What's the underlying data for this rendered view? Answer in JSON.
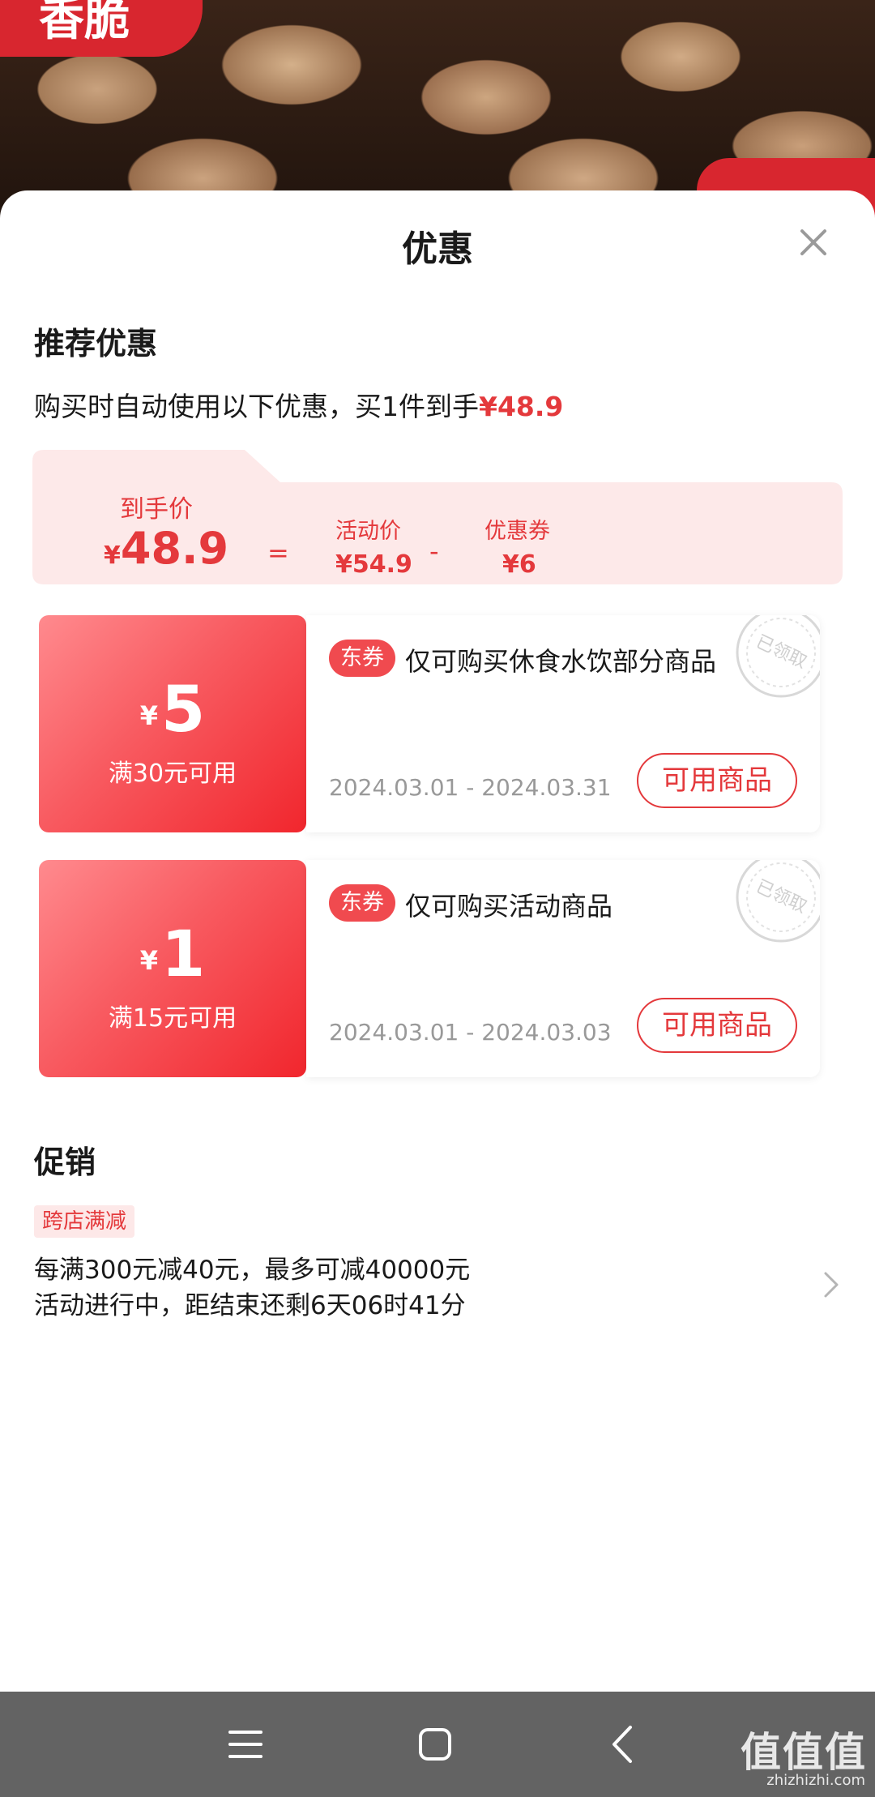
{
  "background": {
    "stamp_text": "香脆"
  },
  "sheet": {
    "title": "优惠",
    "recommend": {
      "title": "推荐优惠",
      "auto_text": "购买时自动使用以下优惠，买1件到手",
      "auto_price": "¥48.9"
    },
    "breakdown": {
      "final_label": "到手价",
      "final_currency": "¥",
      "final_value": "48.9",
      "equals": "=",
      "activity_label": "活动价",
      "activity_price": "¥54.9",
      "minus": "-",
      "coupon_label": "优惠券",
      "coupon_price": "¥6"
    },
    "coupons": [
      {
        "currency": "¥",
        "amount": "5",
        "condition": "满30元可用",
        "tag": "东券",
        "desc": "仅可购买休食水饮部分商品",
        "date": "2024.03.01 - 2024.03.31",
        "button": "可用商品",
        "stamp": "已领取"
      },
      {
        "currency": "¥",
        "amount": "1",
        "condition": "满15元可用",
        "tag": "东券",
        "desc": "仅可购买活动商品",
        "date": "2024.03.01 - 2024.03.03",
        "button": "可用商品",
        "stamp": "已领取"
      }
    ],
    "promotion": {
      "title": "促销",
      "tag": "跨店满减",
      "line1": "每满300元减40元，最多可减40000元",
      "line2": "活动进行中，距结束还剩6天06时41分"
    }
  },
  "watermark": {
    "logo": "值值值",
    "site": "zhizhizhi.com"
  },
  "colors": {
    "accent": "#e4393c",
    "panel": "#fde9e9",
    "navbar": "#636363"
  }
}
